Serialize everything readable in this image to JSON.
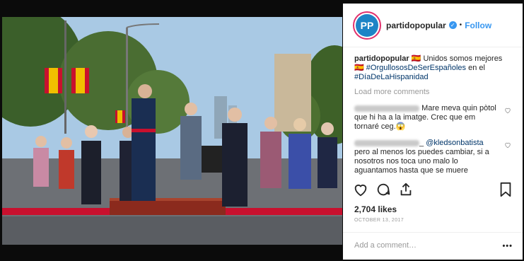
{
  "post": {
    "username": "partidopopular",
    "avatar_text": "PP",
    "verified_mark": "✓",
    "dot": "•",
    "follow_label": "Follow",
    "caption": {
      "username": "partidopopular",
      "flag": "🇪🇸",
      "text_before": "Unidos somos mejores",
      "hashtag1": "#OrgullososDeSerEspañoles",
      "text_middle": "en el",
      "hashtag2": "#DíaDeLaHispanidad"
    },
    "load_more_label": "Load more comments",
    "comments": [
      {
        "text": "Mare meva quin pòtol que hi ha a la imatge. Crec que em tornaré ceg.😱"
      },
      {
        "mention": "@kledsonbatista",
        "text": "pero al menos los puedes cambiar, si a nosotros nos toca uno malo lo aguantamos hasta que se muere"
      }
    ],
    "comment1_suffix": "_",
    "likes": "2,704 likes",
    "date": "OCTOBER 13, 2017",
    "add_comment_placeholder": "Add a comment…",
    "more_label": "•••"
  },
  "colors": {
    "accent_blue": "#3897f0",
    "avatar_blue": "#1d84c6",
    "hashtag": "#003569",
    "carpet_red": "#c8102e"
  },
  "icons": [
    "verified-badge-icon",
    "heart-icon",
    "comment-icon",
    "share-icon",
    "bookmark-icon",
    "small-heart-icon",
    "more-options-icon"
  ]
}
